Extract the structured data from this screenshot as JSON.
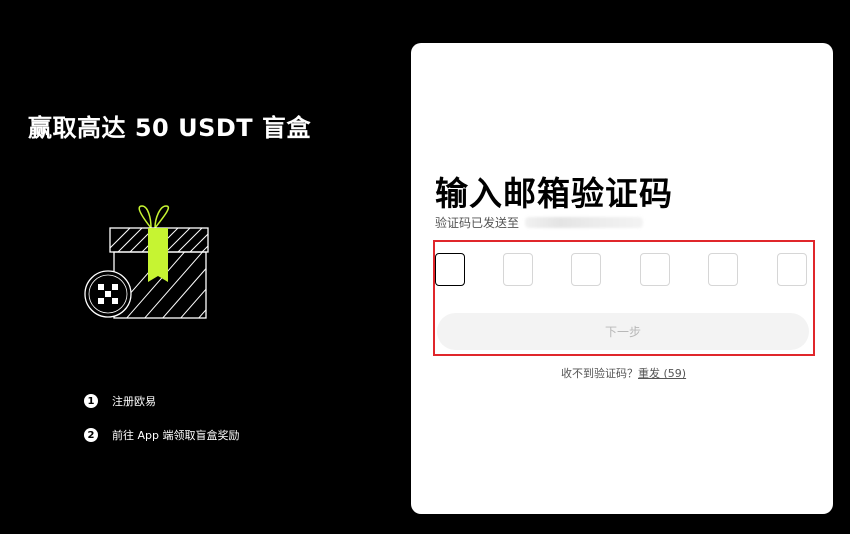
{
  "promo": {
    "title": "赢取高达 50 USDT 盲盒",
    "steps": [
      {
        "num": "1",
        "text": "注册欧易"
      },
      {
        "num": "2",
        "text": "前往 App 端领取盲盒奖励"
      }
    ]
  },
  "form": {
    "title": "输入邮箱验证码",
    "sent_label": "验证码已发送至",
    "code_digits": [
      "",
      "",
      "",
      "",
      "",
      ""
    ],
    "next_label": "下一步",
    "not_received": "收不到验证码？",
    "resend_label": "重发",
    "resend_countdown": "(59)"
  },
  "colors": {
    "accent": "#c6f432",
    "highlight": "#e0262b"
  }
}
